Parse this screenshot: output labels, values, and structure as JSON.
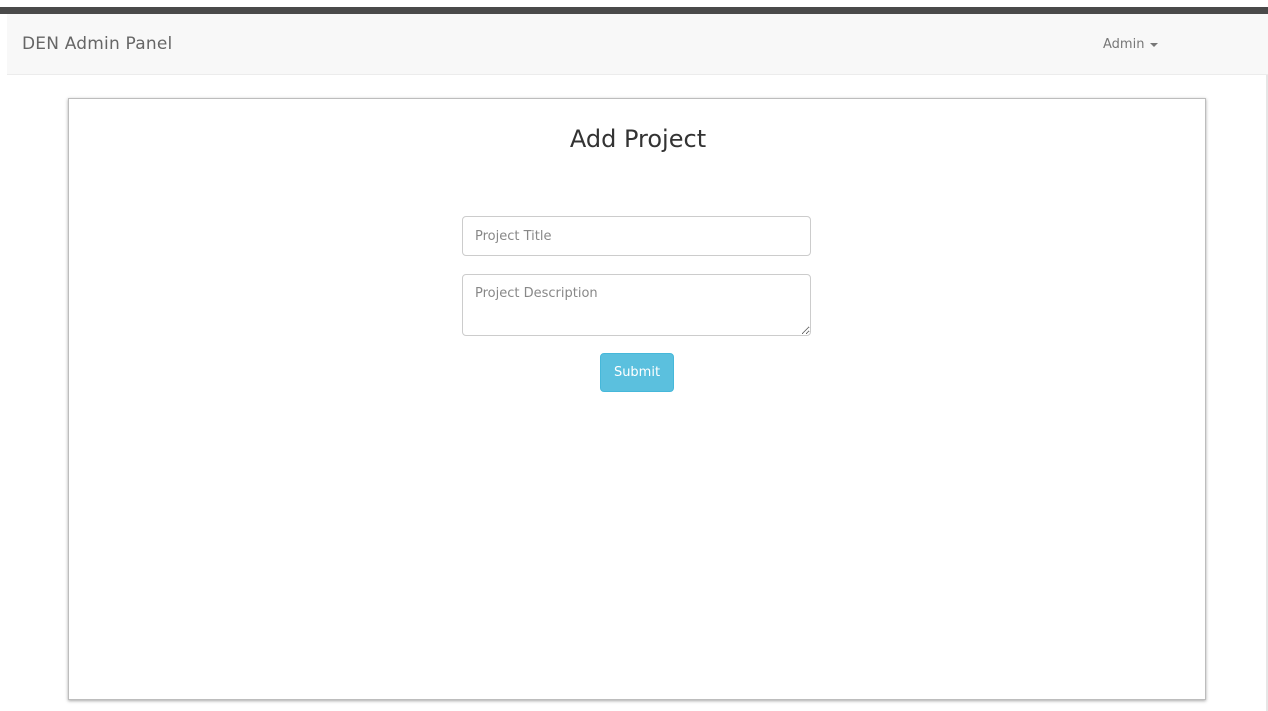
{
  "navbar": {
    "brand": "DEN Admin Panel",
    "user_menu_label": "Admin",
    "user_menu_icon": "caret-down-icon"
  },
  "form": {
    "heading": "Add Project",
    "title_placeholder": "Project Title",
    "title_value": "",
    "description_placeholder": "Project Description",
    "description_value": "",
    "submit_label": "Submit"
  },
  "colors": {
    "submit_button": "#5bc0de",
    "navbar_background": "#f8f8f8",
    "top_bar": "#4a4a4a"
  }
}
